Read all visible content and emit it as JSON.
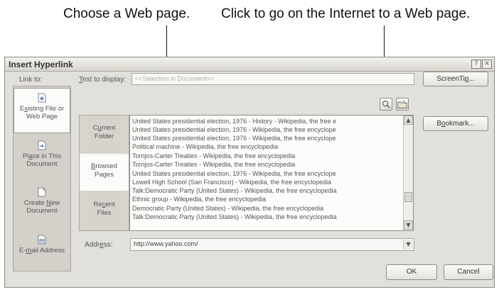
{
  "callouts": {
    "left": "Choose a Web page.",
    "right": "Click to go on the Internet to a Web page."
  },
  "window": {
    "title": "Insert Hyperlink",
    "help_glyph": "?",
    "close_glyph": "×"
  },
  "link_to": {
    "label": "Link to:",
    "items": [
      {
        "pre": "E",
        "key": "x",
        "post": "isting File or",
        "line2": "Web Page",
        "icon": "file-icon",
        "active": true
      },
      {
        "pre": "Pl",
        "key": "a",
        "post": "ce in This",
        "line2": "Document",
        "icon": "place-icon",
        "active": false
      },
      {
        "pre": "Create ",
        "key": "N",
        "post": "ew",
        "line2": "Document",
        "icon": "new-doc-icon",
        "active": false
      },
      {
        "pre": "E-",
        "key": "m",
        "post": "ail Address",
        "line2": "",
        "icon": "email-icon",
        "active": false
      }
    ]
  },
  "text_to_display": {
    "label_key": "T",
    "label_rest": "ext to display:",
    "value": "<<Selection in Document>>"
  },
  "buttons": {
    "screentip_pre": "ScreenTi",
    "screentip_key": "p",
    "screentip_post": "...",
    "bookmark_pre": "B",
    "bookmark_key": "o",
    "bookmark_post": "okmark...",
    "ok": "OK",
    "cancel": "Cancel"
  },
  "toolbar_icons": {
    "browse_web": "browse-web-icon",
    "browse_file": "browse-file-icon"
  },
  "look_in": [
    {
      "pre": "C",
      "key": "u",
      "post": "rrent",
      "line2": "Folder",
      "active": false
    },
    {
      "pre": "",
      "key": "B",
      "post": "rowsed",
      "line2": "Pages",
      "active": true
    },
    {
      "pre": "Re",
      "key": "c",
      "post": "ent",
      "line2": "Files",
      "active": false
    }
  ],
  "pages": [
    "United States presidential election, 1976 - History - Wikipedia, the free e",
    "United States presidential election, 1976 - Wikipedia, the free encyclope",
    "United States presidential election, 1976 - Wikipedia, the free encyclope",
    "Political machine - Wikipedia, the free encyclopedia",
    "Torrijos-Carter Treaties - Wikipedia, the free encyclopedia",
    "Torrijos-Carter Treaties - Wikipedia, the free encyclopedia",
    "United States presidential election, 1976 - Wikipedia, the free encyclope",
    "Lowell High School (San Francisco) - Wikipedia, the free encyclopedia",
    "Talk:Democratic Party (United States) - Wikipedia, the free encyclopedia",
    "Ethnic group - Wikipedia, the free encyclopedia",
    "Democratic Party (United States) - Wikipedia, the free encyclopedia",
    "Talk:Democratic Party (United States) - Wikipedia, the free encyclopedia"
  ],
  "address": {
    "label_pre": "Addr",
    "label_key": "e",
    "label_post": "ss:",
    "value": "http://www.yahoo.com/"
  },
  "colors": {
    "dialog_bg": "#e2e0da",
    "selected_bg": "#fbfbf9"
  }
}
